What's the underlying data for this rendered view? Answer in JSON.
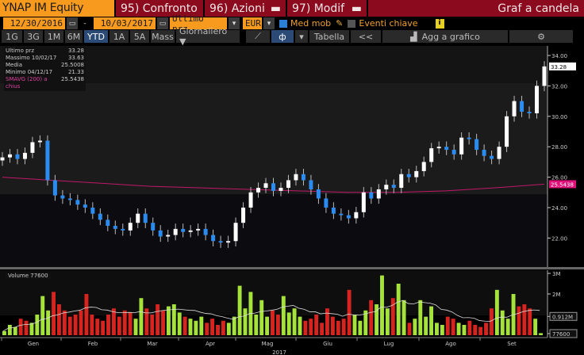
{
  "header": {
    "ticker": "YNAP IM Equity",
    "btn95": "95) Confronto",
    "btn96": "96) Azioni",
    "btn97": "97) Modif",
    "title": "Graf a candela"
  },
  "controls": {
    "start_date": "12/30/2016",
    "end_date": "10/03/2017",
    "dash": "-",
    "field": "Ultimo prz",
    "currency": "EUR",
    "med_mob": "Med mob",
    "eventi": "Eventi chiave",
    "info": "i"
  },
  "toolbar": {
    "periods": [
      "1G",
      "3G",
      "1M",
      "6M",
      "YTD",
      "1A",
      "5A",
      "Mass"
    ],
    "active": "YTD",
    "frequency": "Giornaliero ▼",
    "tabella": "Tabella",
    "back": "<<",
    "add": "Agg a grafico",
    "settings": "⚙"
  },
  "legend": [
    {
      "label": "Ultimo prz",
      "value": "33.28"
    },
    {
      "label": "Massimo 10/02/17",
      "value": "33.63"
    },
    {
      "label": "Media",
      "value": "25.5008"
    },
    {
      "label": "Minimo 04/12/17",
      "value": "21.33"
    },
    {
      "label": "SMAVG (200) a chius",
      "value": "25.5438"
    }
  ],
  "volume_legend": "Volume 77600",
  "colors": {
    "up": "#ffffff",
    "down": "#2a8cf0",
    "smavg": "#c0186a",
    "vol_up": "#a6e33a",
    "vol_down": "#d8241f"
  },
  "chart_data": {
    "type": "candlestick",
    "price_axis": {
      "ticks": [
        "34.00",
        "32.00",
        "30.00",
        "28.00",
        "26.00",
        "24.00",
        "22.00"
      ],
      "range": [
        20.9,
        34.6
      ]
    },
    "last_label": "33.28",
    "smavg_label": "25.5438",
    "x_ticks": [
      "Gen",
      "Feb",
      "Mar",
      "Apr",
      "Mag",
      "Giu",
      "Lug",
      "Ago",
      "Set"
    ],
    "year": "2017",
    "closes": [
      27.3,
      27.5,
      27.2,
      27.6,
      28.3,
      28.4,
      25.8,
      24.8,
      24.6,
      24.5,
      24.2,
      24.0,
      23.6,
      23.2,
      22.8,
      22.6,
      22.5,
      23.0,
      23.6,
      23.0,
      22.5,
      22.1,
      22.2,
      22.6,
      22.4,
      22.5,
      22.6,
      22.2,
      21.8,
      21.7,
      21.8,
      23.0,
      24.0,
      25.0,
      25.3,
      25.6,
      25.1,
      25.3,
      25.8,
      26.2,
      25.8,
      25.2,
      24.6,
      24.0,
      23.6,
      23.5,
      23.3,
      23.7,
      25.0,
      24.6,
      25.2,
      25.5,
      25.3,
      26.2,
      26.0,
      26.4,
      27.0,
      27.9,
      28.0,
      27.8,
      27.5,
      28.6,
      28.5,
      27.8,
      27.4,
      27.2,
      28.0,
      30.0,
      31.0,
      30.3,
      30.2,
      32.0,
      33.28
    ],
    "smavg": [
      26.0,
      25.8,
      25.6,
      25.4,
      25.3,
      25.2,
      25.1,
      25.0,
      25.0,
      25.1,
      25.3,
      25.54
    ],
    "volume_axis": {
      "ticks": [
        "3M",
        "2M",
        "0.912M",
        "77600"
      ]
    },
    "volume_M": [
      0.2,
      0.5,
      0.4,
      0.8,
      0.7,
      0.6,
      1.0,
      1.9,
      1.2,
      2.1,
      1.5,
      1.2,
      0.9,
      1.0,
      1.2,
      2.0,
      1.0,
      0.8,
      0.7,
      1.0,
      1.3,
      0.9,
      1.2,
      1.1,
      0.8,
      1.8,
      1.3,
      1.0,
      1.5,
      1.2,
      1.4,
      1.5,
      1.1,
      0.9,
      0.8,
      0.7,
      0.9,
      0.6,
      0.8,
      0.5,
      0.7,
      0.6,
      0.9,
      2.4,
      1.3,
      2.1,
      1.0,
      1.7,
      0.9,
      1.2,
      1.0,
      1.9,
      1.1,
      1.3,
      0.9,
      0.7,
      0.8,
      1.0,
      0.6,
      1.3,
      0.9,
      0.7,
      0.8,
      2.2,
      1.0,
      0.7,
      1.2,
      1.7,
      1.5,
      2.9,
      1.3,
      1.8,
      2.5,
      1.7,
      0.6,
      0.8,
      1.7,
      0.9,
      1.4,
      0.6,
      0.5,
      0.9,
      0.8,
      0.6,
      0.5,
      0.7,
      0.5,
      0.4,
      0.6,
      1.3,
      2.2,
      1.2,
      0.8,
      2.0,
      1.4,
      1.5,
      1.3,
      0.8,
      0.1
    ]
  }
}
